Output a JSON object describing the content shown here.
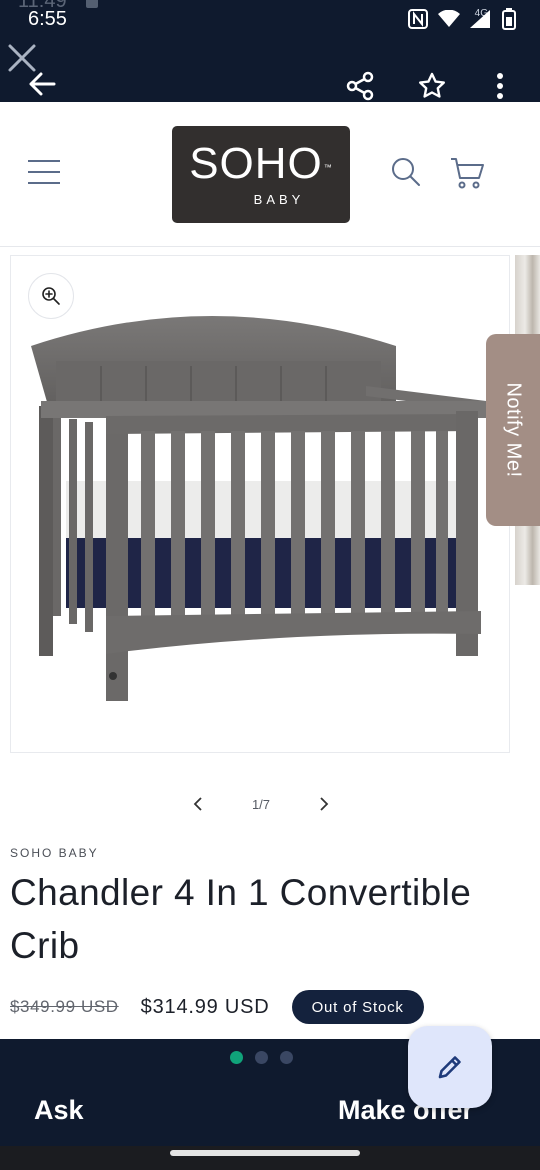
{
  "status_bar": {
    "ghost_time": "11:49",
    "time": "6:55",
    "network": "4G"
  },
  "toolbar": {
    "close_icon": "close-icon",
    "back_icon": "arrow-left-icon",
    "share_icon": "share-icon",
    "star_icon": "star-outline-icon",
    "more_icon": "more-vert-icon"
  },
  "header": {
    "logo_main": "SOHO",
    "logo_tm": "™",
    "logo_sub": "BABY"
  },
  "gallery": {
    "notify_label": "Notify Me!",
    "pager": "1/7"
  },
  "product": {
    "vendor": "SOHO BABY",
    "title": "Chandler 4 In 1 Convertible Crib",
    "price_old": "$349.99 USD",
    "price_new": "$314.99 USD",
    "stock_status": "Out of Stock"
  },
  "bottom_bar": {
    "ask_label": "Ask",
    "offer_label": "Make offer",
    "pages": 3,
    "active_page": 1
  },
  "colors": {
    "dark_bar": "#0f1a2e",
    "badge": "#14223d",
    "notify_tab": "#a38e85",
    "crib_gray": "#6e6c6b",
    "active_dot": "#10a37a"
  }
}
